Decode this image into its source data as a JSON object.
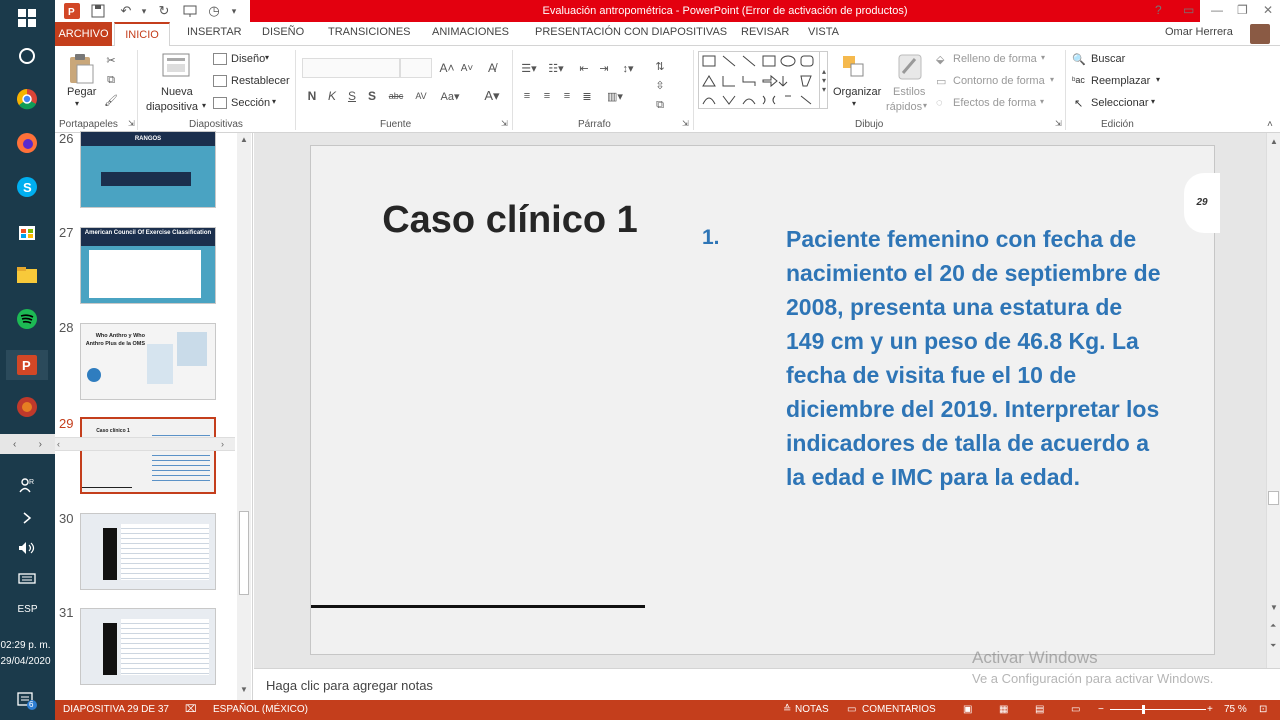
{
  "title_bar": {
    "title": "Evaluación antropométrica -  PowerPoint (Error de activación de productos)",
    "user": "Omar Herrera"
  },
  "tabs": [
    "ARCHIVO",
    "INICIO",
    "INSERTAR",
    "DISEÑO",
    "TRANSICIONES",
    "ANIMACIONES",
    "PRESENTACIÓN CON DIAPOSITIVAS",
    "REVISAR",
    "VISTA"
  ],
  "ribbon": {
    "portapapeles": {
      "label": "Portapapeles",
      "pegar": "Pegar"
    },
    "diapositivas": {
      "label": "Diapositivas",
      "nueva_1": "Nueva",
      "nueva_2": "diapositiva",
      "diseno": "Diseño",
      "restablecer": "Restablecer",
      "seccion": "Sección"
    },
    "fuente": {
      "label": "Fuente"
    },
    "parrafo": {
      "label": "Párrafo"
    },
    "dibujo": {
      "label": "Dibujo",
      "organizar": "Organizar",
      "estilos_1": "Estilos",
      "estilos_2": "rápidos",
      "relleno": "Relleno de forma",
      "contorno": "Contorno de forma",
      "efectos": "Efectos de forma"
    },
    "edicion": {
      "label": "Edición",
      "buscar": "Buscar",
      "reemplazar": "Reemplazar",
      "seleccionar": "Seleccionar"
    }
  },
  "thumbnails": [
    {
      "num": "26",
      "caption": "RANGOS"
    },
    {
      "num": "27",
      "caption": "American Council Of Exercise Classification"
    },
    {
      "num": "28",
      "caption": "Who Anthro y Who Anthro Plus de la OMS"
    },
    {
      "num": "29",
      "caption": "Caso clínico 1"
    },
    {
      "num": "30",
      "caption": ""
    },
    {
      "num": "31",
      "caption": ""
    }
  ],
  "slide": {
    "title": "Caso clínico 1",
    "list_number": "1.",
    "body": "Paciente femenino con fecha de nacimiento el 20 de septiembre de 2008, presenta una estatura de 149 cm y un peso de 46.8 Kg. La fecha de visita fue el 10 de diciembre del 2019. Interpretar los indicadores de talla de acuerdo a la edad e IMC para la edad.",
    "page_badge": "29"
  },
  "notes_placeholder": "Haga clic para agregar notas",
  "watermark": {
    "line1": "Activar Windows",
    "line2": "Ve a Configuración para activar Windows."
  },
  "status": {
    "slide": "DIAPOSITIVA 29 DE 37",
    "language": "ESPAÑOL (MÉXICO)",
    "notes": "NOTAS",
    "comments": "COMENTARIOS",
    "zoom": "75 %"
  },
  "taskbar": {
    "lang": "ESP",
    "time": "02:29 p. m.",
    "date": "29/04/2020",
    "notif_count": "6"
  },
  "colors": {
    "accent": "#c43e1c",
    "title_red": "#e3000f",
    "slide_text_blue": "#2e75b6",
    "taskbar": "#1b3a4b"
  }
}
